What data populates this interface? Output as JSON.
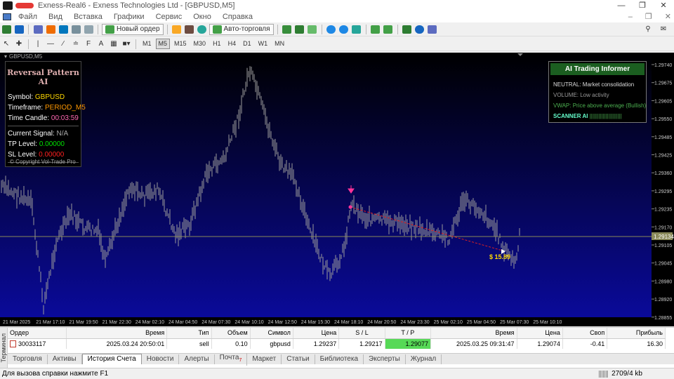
{
  "window": {
    "title": "Exness-Real6 - Exness Technologies Ltd - [GBPUSD,M5]",
    "minimize": "—",
    "restore": "❐",
    "close": "✕"
  },
  "menu": {
    "items": [
      "Файл",
      "Вид",
      "Вставка",
      "Графики",
      "Сервис",
      "Окно",
      "Справка"
    ]
  },
  "toolbar": {
    "new_order": "Новый ордер",
    "autotrading": "Авто-торговля",
    "text_tool": "A",
    "timeframes": [
      "M1",
      "M5",
      "M15",
      "M30",
      "H1",
      "H4",
      "D1",
      "W1",
      "MN"
    ],
    "active_timeframe": "M5"
  },
  "chart": {
    "tab_label": "GBPUSD,M5",
    "price_ticks": [
      "1.29740",
      "1.29675",
      "1.29605",
      "1.29550",
      "1.29485",
      "1.29425",
      "1.29360",
      "1.29295",
      "1.29235",
      "1.29170",
      "1.29105",
      "1.29045",
      "1.28980",
      "1.28920",
      "1.28855"
    ],
    "current_price": "1.29134",
    "time_ticks": [
      "21 Mar 2025",
      "21 Mar 17:10",
      "21 Mar 19:50",
      "21 Mar 22:30",
      "24 Mar 02:10",
      "24 Mar 04:50",
      "24 Mar 07:30",
      "24 Mar 10:10",
      "24 Mar 12:50",
      "24 Mar 15:30",
      "24 Mar 18:10",
      "24 Mar 20:50",
      "24 Mar 23:30",
      "25 Mar 02:10",
      "25 Mar 04:50",
      "25 Mar 07:30",
      "25 Mar 10:10"
    ],
    "profit_label": "$ 15.89",
    "colors": {
      "bg_top": "#000000",
      "bg_bottom": "#0a0a9a",
      "price_line": "#8a8a5a",
      "trade_line": "#e02020",
      "candles": "#9a9a9a"
    }
  },
  "reversal_panel": {
    "title": "Reversal Pattern AI",
    "symbol_label": "Symbol:",
    "symbol_value": "GBPUSD",
    "timeframe_label": "Timeframe:",
    "timeframe_value": "PERIOD_M5",
    "candle_label": "Time Candle:",
    "candle_value": "00:03:59",
    "signal_label": "Current Signal:",
    "signal_value": "N/A",
    "tp_label": "TP Level:",
    "tp_value": "0.00000",
    "sl_label": "SL Level:",
    "sl_value": "0.00000",
    "copyright": "© Copyright Vol-Trade Pro"
  },
  "ai_panel": {
    "title": "AI Trading Informer",
    "line1_key": "NEUTRAL:",
    "line1_value": "Market consolidation",
    "line2": "VOLUME: Low activity",
    "line3": "VWAP: Price above average (Bullish)",
    "scanner_label": "SCANNER AI",
    "scanner_bar": "||||||||||||||||||||||"
  },
  "terminal": {
    "side_label": "Терминал",
    "columns": [
      "Ордер",
      "Время",
      "Тип",
      "Объем",
      "Символ",
      "Цена",
      "S / L",
      "T / P",
      "Время",
      "Цена",
      "Своп",
      "Прибыль"
    ],
    "row": [
      "30033117",
      "2025.03.24 20:50:01",
      "sell",
      "0.10",
      "gbpusd",
      "1.29237",
      "1.29217",
      "1.29077",
      "2025.03.25 09:31:47",
      "1.29074",
      "-0.41",
      "16.30"
    ],
    "tabs": [
      "Торговля",
      "Активы",
      "История Счета",
      "Новости",
      "Алерты",
      "Почта",
      "Маркет",
      "Статьи",
      "Библиотека",
      "Эксперты",
      "Журнал"
    ],
    "active_tab": "История Счета",
    "mail_badge": "7"
  },
  "status": {
    "help": "Для вызова справки нажмите F1",
    "traffic": "2709/4 kb"
  }
}
